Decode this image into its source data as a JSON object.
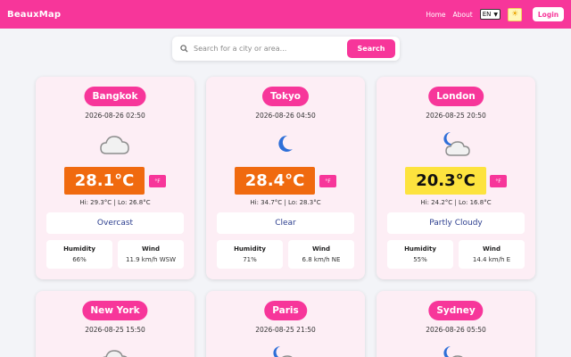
{
  "nav": {
    "brand": "BeauxMap",
    "home": "Home",
    "about": "About",
    "language": "EN",
    "login": "Login"
  },
  "search": {
    "placeholder": "Search for a city or area...",
    "button": "Search"
  },
  "labels": {
    "humidity": "Humidity",
    "wind": "Wind",
    "unit_toggle": "°F"
  },
  "cards": [
    {
      "city": "Bangkok",
      "time": "2026-08-26 02:50",
      "icon": "cloud-icon",
      "temp": "28.1°C",
      "hilo": "Hi: 29.3°C | Lo: 26.8°C",
      "condition": "Overcast",
      "humidity": "66%",
      "wind": "11.9 km/h WSW"
    },
    {
      "city": "Tokyo",
      "time": "2026-08-26 04:50",
      "icon": "moon-icon",
      "temp": "28.4°C",
      "hilo": "Hi: 34.7°C | Lo: 28.3°C",
      "condition": "Clear",
      "humidity": "71%",
      "wind": "6.8 km/h NE"
    },
    {
      "city": "London",
      "time": "2026-08-25 20:50",
      "icon": "moon-cloud-icon",
      "temp": "20.3°C",
      "hilo": "Hi: 24.2°C | Lo: 16.8°C",
      "condition": "Partly Cloudy",
      "humidity": "55%",
      "wind": "14.4 km/h E"
    },
    {
      "city": "New York",
      "time": "2026-08-25 15:50",
      "icon": "cloud-icon"
    },
    {
      "city": "Paris",
      "time": "2026-08-25 21:50",
      "icon": "moon-cloud-icon"
    },
    {
      "city": "Sydney",
      "time": "2026-08-26 05:50",
      "icon": "moon-cloud-icon"
    }
  ],
  "colors": {
    "accent": "#f7369a",
    "hot": "#f06a0f",
    "warm": "#fde33e",
    "card": "#fdeef5"
  }
}
